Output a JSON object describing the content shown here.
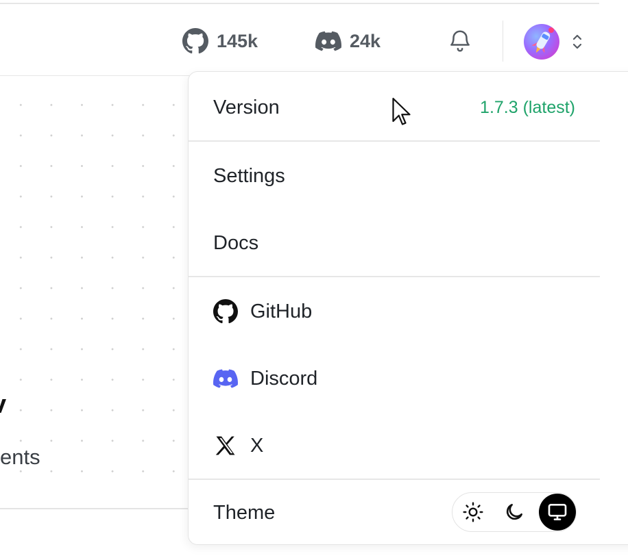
{
  "header": {
    "github_stars": "145k",
    "discord_members": "24k"
  },
  "background": {
    "partial_heading": "v",
    "partial_subtext": "ents"
  },
  "menu": {
    "version_label": "Version",
    "version_value": "1.7.3 (latest)",
    "settings_label": "Settings",
    "docs_label": "Docs",
    "github_label": "GitHub",
    "discord_label": "Discord",
    "x_label": "X",
    "theme_label": "Theme",
    "theme_options": [
      "light",
      "dark",
      "system"
    ],
    "theme_selected": "system"
  },
  "icons": {
    "github": "github-icon",
    "discord": "discord-icon",
    "x": "x-icon",
    "bell": "bell-icon",
    "sun": "sun-icon",
    "moon": "moon-icon",
    "monitor": "monitor-icon"
  },
  "colors": {
    "version_green": "#1fa36a",
    "discord_blurple": "#5865f2",
    "stat_gray": "#555b62"
  }
}
